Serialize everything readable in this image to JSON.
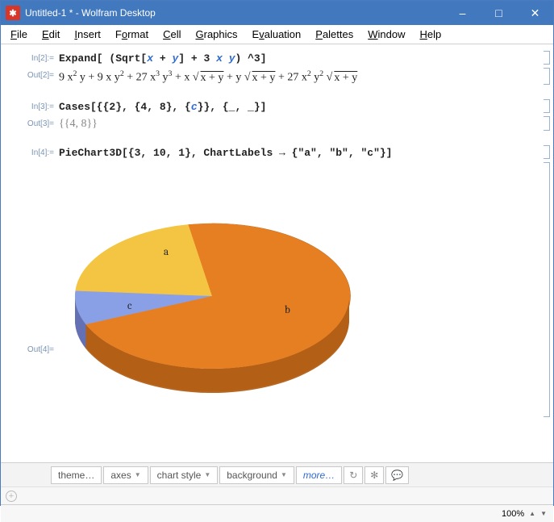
{
  "window": {
    "title": "Untitled-1 * - Wolfram Desktop",
    "appicon_glyph": "✱"
  },
  "menu": {
    "file": "File",
    "edit": "Edit",
    "insert": "Insert",
    "format": "Format",
    "cell": "Cell",
    "graphics": "Graphics",
    "evaluation": "Evaluation",
    "palettes": "Palettes",
    "window": "Window",
    "help": "Help"
  },
  "cells": {
    "in2_label": "In[2]:=",
    "in2_code_prefix": "Expand[ (Sqrt[",
    "in2_code_var1": "x",
    "in2_code_plus1": " + ",
    "in2_code_var2": "y",
    "in2_code_mid": "] + 3 ",
    "in2_code_var3": "x",
    "in2_code_var4": "y",
    "in2_code_suffix": ") ^3]",
    "out2_label": "Out[2]=",
    "out2_expr_html": "9 x<sup>2</sup> y + 9 x y<sup>2</sup> + 27 x<sup>3</sup> y<sup>3</sup> + x √<span class=\"sqrt\">x + y</span> + y √<span class=\"sqrt\">x + y</span> + 27 x<sup>2</sup> y<sup>2</sup> √<span class=\"sqrt\">x + y</span>",
    "in3_label": "In[3]:=",
    "in3_code_prefix": "Cases[{{2}, {4, 8}, {",
    "in3_code_var": "c",
    "in3_code_suffix": "}}, {_, _}]",
    "out3_label": "Out[3]=",
    "out3_expr": "{{4, 8}}",
    "in4_label": "In[4]:=",
    "in4_code": "PieChart3D[{3, 10, 1}, ChartLabels → {\"a\", \"b\", \"c\"}]",
    "out4_label": "Out[4]="
  },
  "chart_data": {
    "type": "pie",
    "title": "",
    "series": [
      {
        "name": "a",
        "value": 3,
        "color": "#f4c542"
      },
      {
        "name": "b",
        "value": 10,
        "color": "#e67e22"
      },
      {
        "name": "c",
        "value": 1,
        "color": "#8aa0e6"
      }
    ],
    "labels": [
      "a",
      "b",
      "c"
    ],
    "style": "3D"
  },
  "toolbar": {
    "theme": "theme…",
    "axes": "axes",
    "chart_style": "chart style",
    "background": "background",
    "more": "more…"
  },
  "status": {
    "zoom": "100%"
  }
}
